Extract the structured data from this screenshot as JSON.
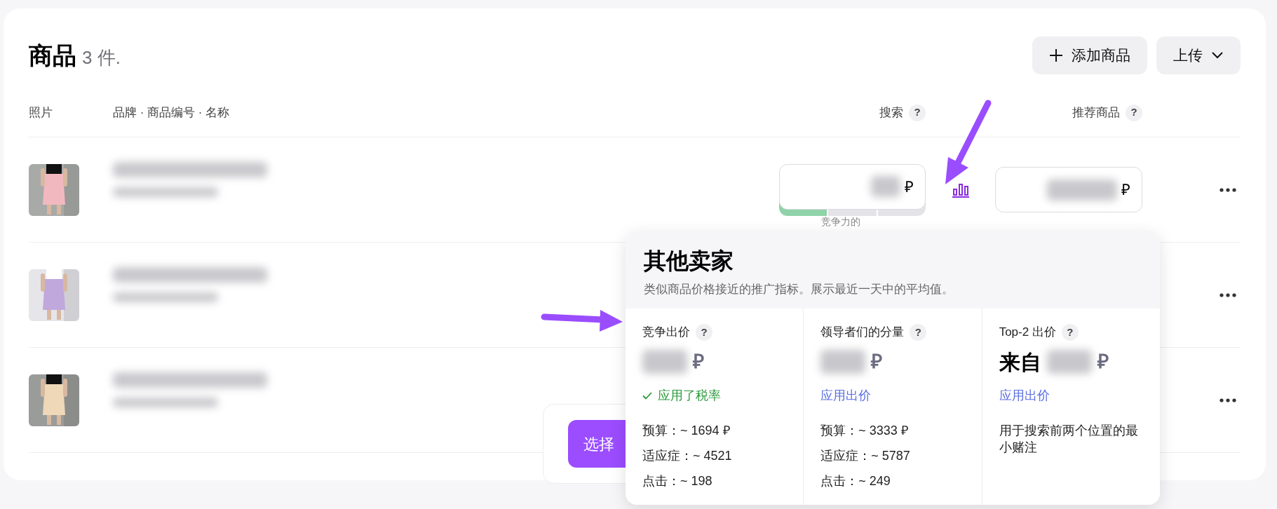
{
  "page": {
    "title": "商品",
    "count": "3 件."
  },
  "actions": [
    {
      "kind": "add",
      "label": "添加商品"
    },
    {
      "kind": "menu",
      "label": "上传"
    }
  ],
  "columns": [
    {
      "label": "照片"
    },
    {
      "label": "品牌 · 商品编号 · 名称"
    },
    {
      "label": "搜索",
      "help": "?"
    },
    {
      "label": "推荐商品",
      "help": "?"
    }
  ],
  "rows": [
    {
      "photo": {
        "kind": "picture"
      },
      "search_bid": {
        "currency": "₽",
        "competitiveness": {
          "label": "竞争力的",
          "level": 0.33
        }
      },
      "recommend_bid": {
        "currency": "₽"
      }
    },
    {
      "photo": {
        "kind": "picture"
      }
    },
    {
      "photo": {
        "kind": "picture"
      }
    }
  ],
  "popup": {
    "title": "其他卖家",
    "subtitle": "类似商品价格接近的推广指标。展示最近一天中的平均值。",
    "columns": [
      {
        "label": "竞争出价",
        "help": "?",
        "currency": "₽",
        "action": {
          "kind": "applied",
          "label": "应用了税率"
        },
        "stats": [
          "预算：~ 1694 ₽",
          "适应症：~ 4521",
          "点击：~ 198"
        ]
      },
      {
        "label": "领导者们的分量",
        "help": "?",
        "currency": "₽",
        "action": {
          "kind": "link",
          "label": "应用出价"
        },
        "stats": [
          "预算：~ 3333 ₽",
          "适应症：~ 5787",
          "点击：~ 249"
        ]
      },
      {
        "label": "Top-2 出价",
        "help": "?",
        "prefix": "来自",
        "currency": "₽",
        "action": {
          "kind": "link",
          "label": "应用出价"
        },
        "note": "用于搜索前两个位置的最小赌注"
      }
    ]
  },
  "bottom_bar": {
    "button": "选择"
  }
}
